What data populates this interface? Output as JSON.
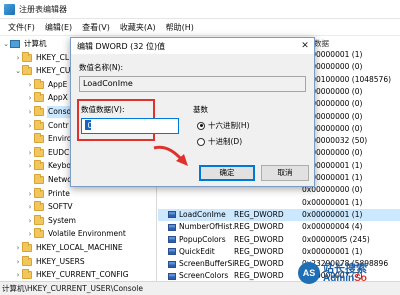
{
  "window": {
    "title": "注册表编辑器"
  },
  "menu": [
    "文件(F)",
    "编辑(E)",
    "查看(V)",
    "收藏夹(A)",
    "帮助(H)"
  ],
  "tree": {
    "items": [
      {
        "label": "计算机",
        "icon": "computer-icon",
        "chevron": "down"
      },
      {
        "label": "HKEY_CL",
        "icon": "folder-icon",
        "chevron": "right"
      },
      {
        "label": "HKEY_CU",
        "icon": "folder-icon",
        "chevron": "down"
      },
      {
        "label": "AppE",
        "icon": "folder-icon",
        "chevron": "right"
      },
      {
        "label": "AppX",
        "icon": "folder-icon",
        "chevron": "right"
      },
      {
        "label": "Conso",
        "icon": "folder-icon",
        "chevron": "right",
        "selected": true
      },
      {
        "label": "Contr",
        "icon": "folder-icon",
        "chevron": "right"
      },
      {
        "label": "Enviro",
        "icon": "folder-icon",
        "chevron": ""
      },
      {
        "label": "EUDC",
        "icon": "folder-icon",
        "chevron": "right"
      },
      {
        "label": "Keybo",
        "icon": "folder-icon",
        "chevron": "right"
      },
      {
        "label": "Netwo",
        "icon": "folder-icon",
        "chevron": ""
      },
      {
        "label": "Printe",
        "icon": "folder-icon",
        "chevron": "right"
      },
      {
        "label": "SOFTV",
        "icon": "folder-icon",
        "chevron": "right"
      },
      {
        "label": "System",
        "icon": "folder-icon",
        "chevron": "right"
      },
      {
        "label": "Volatile Environment",
        "icon": "folder-icon",
        "chevron": "right"
      },
      {
        "label": "HKEY_LOCAL_MACHINE",
        "icon": "folder-icon",
        "chevron": "right"
      },
      {
        "label": "HKEY_USERS",
        "icon": "folder-icon",
        "chevron": "right"
      },
      {
        "label": "HKEY_CURRENT_CONFIG",
        "icon": "folder-icon",
        "chevron": "right"
      }
    ]
  },
  "list": {
    "header_data": "数据",
    "rows": [
      {
        "name": "",
        "type": "",
        "data": "0x00000001 (1)"
      },
      {
        "name": "",
        "type": "",
        "data": "0x00000000 (0)"
      },
      {
        "name": "",
        "type": "",
        "data": "0x00100000 (1048576)"
      },
      {
        "name": "",
        "type": "",
        "data": "0x00000000 (0)"
      },
      {
        "name": "",
        "type": "",
        "data": "0x00000000 (0)"
      },
      {
        "name": "",
        "type": "",
        "data": "0x00000000 (0)"
      },
      {
        "name": "",
        "type": "",
        "data": "0x00000000 (0)"
      },
      {
        "name": "",
        "type": "",
        "data": "0x00000032 (50)"
      },
      {
        "name": "",
        "type": "",
        "data": "0x00000000 (0)"
      },
      {
        "name": "",
        "type": "",
        "data": "0x00000001 (1)"
      },
      {
        "name": "",
        "type": "",
        "data": "0x00000001 (1)"
      },
      {
        "name": "",
        "type": "",
        "data": "0x00000000 (0)"
      },
      {
        "name": "",
        "type": "",
        "data": "0x00000001 (1)"
      },
      {
        "name": "LoadConIme",
        "type": "REG_DWORD",
        "data": "0x00000001 (1)",
        "selected": true
      },
      {
        "name": "NumberOfHist...",
        "type": "REG_DWORD",
        "data": "0x00000004 (4)"
      },
      {
        "name": "PopupColors",
        "type": "REG_DWORD",
        "data": "0x000000f5 (245)"
      },
      {
        "name": "QuickEdit",
        "type": "REG_DWORD",
        "data": "0x00000001 (1)"
      },
      {
        "name": "ScreenBufferSi...",
        "type": "REG_DWORD",
        "data": "0x23290078 (5898896"
      },
      {
        "name": "ScreenColors",
        "type": "REG_DWORD",
        "data": "0x00000007 (7)"
      }
    ]
  },
  "status": {
    "path": "计算机\\HKEY_CURRENT_USER\\Console"
  },
  "dialog": {
    "title": "编辑 DWORD (32 位)值",
    "close_glyph": "✕",
    "value_name_label": "数值名称(N):",
    "value_name": "LoadConIme",
    "value_data_label": "数值数据(V):",
    "value_data": "0",
    "base_label": "基数",
    "radio_hex": "十六进制(H)",
    "radio_dec": "十进制(D)",
    "base_selected": "hex",
    "ok": "确定",
    "cancel": "取消"
  },
  "watermark": {
    "line1": "站长搜索",
    "line2_a": "Admin",
    "line2_b": "So",
    "logo": "AS"
  },
  "colors": {
    "selection": "#cce8ff",
    "highlight_red": "#e0322b",
    "accent": "#0078d7"
  }
}
